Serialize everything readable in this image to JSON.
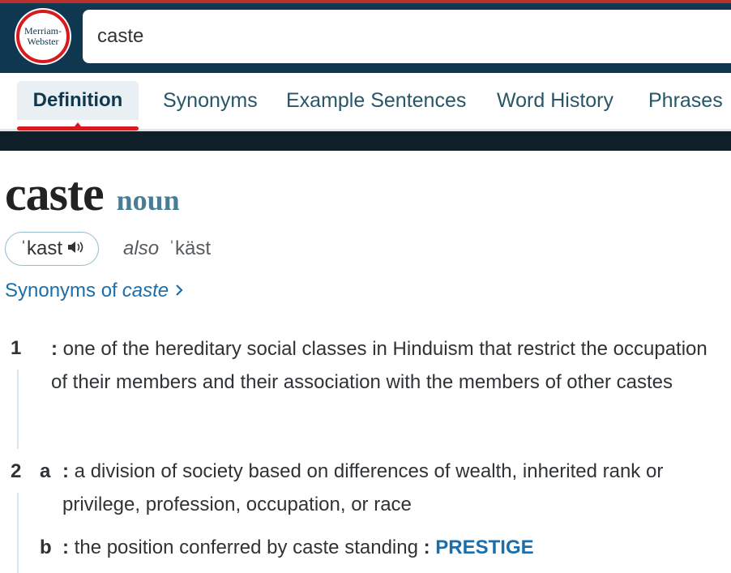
{
  "header": {
    "logo_line1": "Merriam-",
    "logo_line2": "Webster",
    "search_value": "caste"
  },
  "tabs": [
    {
      "label": "Definition",
      "active": true
    },
    {
      "label": "Synonyms"
    },
    {
      "label": "Example Sentences"
    },
    {
      "label": "Word History"
    },
    {
      "label": "Phrases"
    }
  ],
  "entry": {
    "headword": "caste",
    "part_of_speech": "noun",
    "pronunciation": "ˈkast",
    "also_label": "also",
    "alt_pronunciation": "ˈkäst",
    "synonyms_link_prefix": "Synonyms of",
    "synonyms_link_word": "caste"
  },
  "senses": [
    {
      "number": "1",
      "text": "one of the hereditary social classes in Hinduism that restrict the occupation of their members and their association with the members of other castes"
    },
    {
      "number": "2",
      "letter": "a",
      "text": "a division of society based on differences of wealth, inherited rank or privilege, profession, occupation, or race"
    },
    {
      "letter": "b",
      "text": "the position conferred by caste standing",
      "synonym_xref": "PRESTIGE"
    }
  ],
  "colors": {
    "header_bg": "#0f3850",
    "accent_red": "#d71920",
    "link_blue": "#1b6ea9",
    "pos_color": "#4a7d95"
  },
  "icons": [
    "speaker-icon",
    "chevron-right-icon"
  ]
}
